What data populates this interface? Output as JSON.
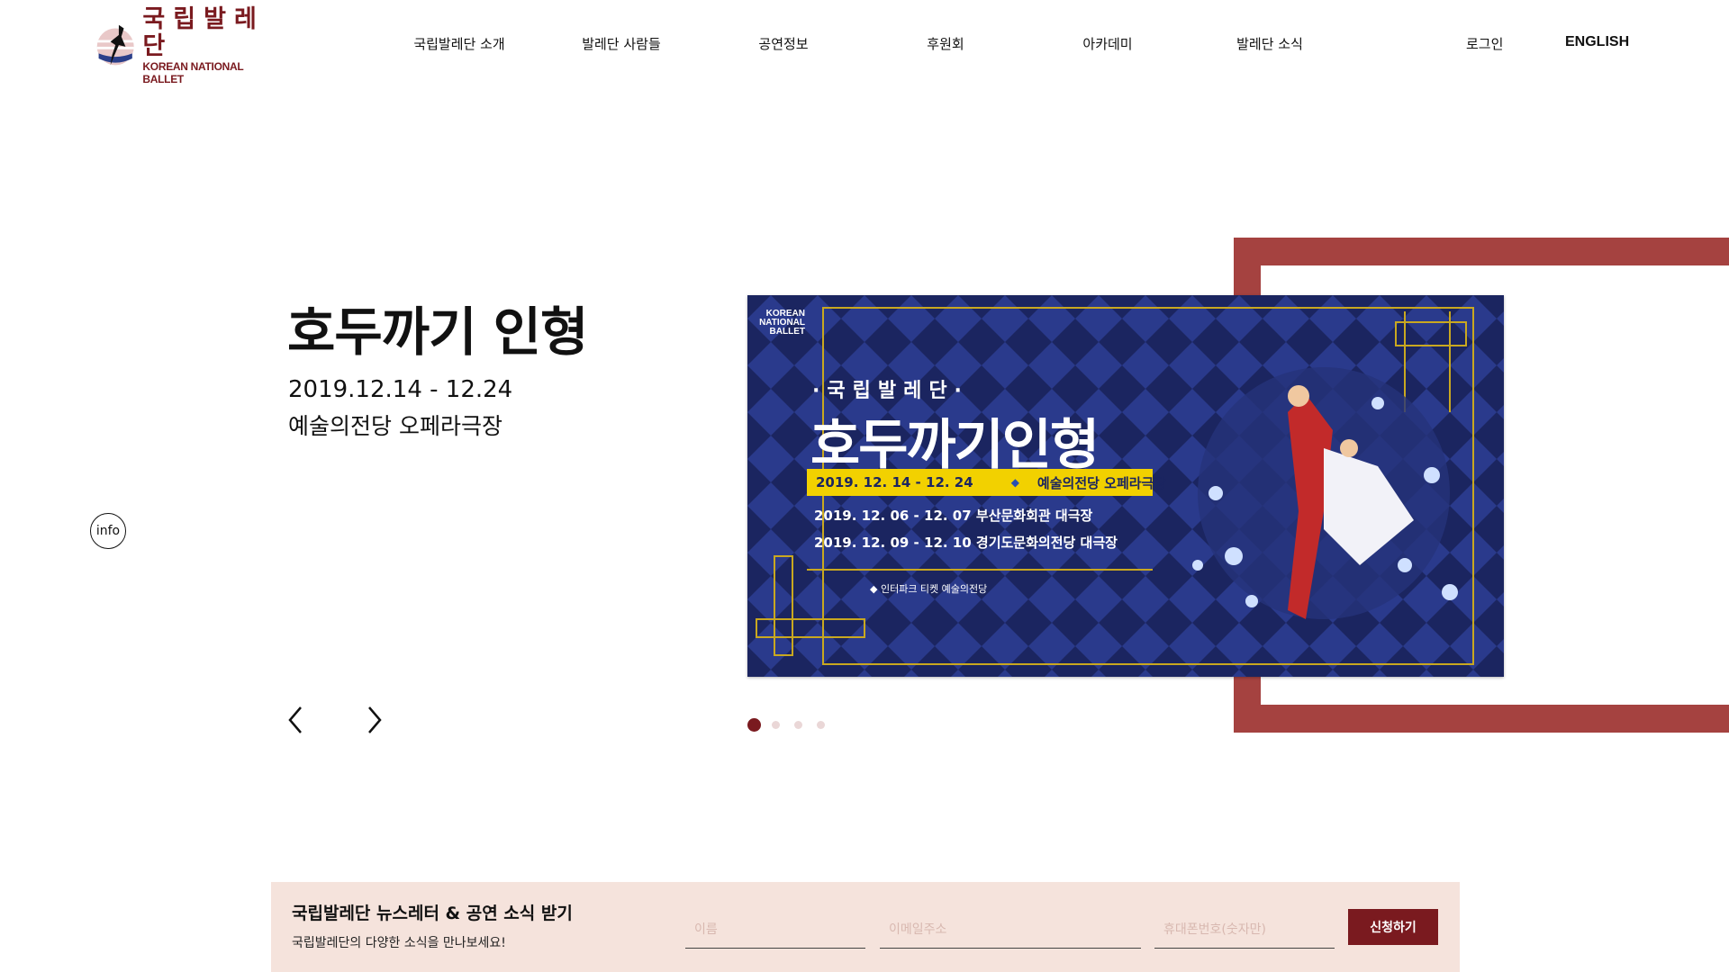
{
  "brand": {
    "name_kr": "국립발레단",
    "name_en": "KOREAN NATIONAL BALLET",
    "color": "#7a1a1f"
  },
  "nav": {
    "items": [
      {
        "label": "국립발레단 소개"
      },
      {
        "label": "발레단 사람들"
      },
      {
        "label": "공연정보"
      },
      {
        "label": "후원회"
      },
      {
        "label": "아카데미"
      },
      {
        "label": "발레단 소식"
      }
    ],
    "login": "로그인",
    "english": "ENGLISH"
  },
  "hero": {
    "title": "호두까기 인형",
    "date": "2019.12.14 - 12.24",
    "venue": "예술의전당 오페라극장",
    "info_label": "info",
    "prev_icon": "chevron-left-icon",
    "next_icon": "chevron-right-icon"
  },
  "poster": {
    "brand_en": "KOREAN NATIONAL BALLET",
    "brand_kr": "국립발레단",
    "subtitle": "·국립발레단·",
    "title": "호두까기인형",
    "band_date": "2019. 12. 14 - 12. 24",
    "band_venue": "예술의전당 오페라극장",
    "line1": "2019. 12. 06 - 12. 07  부산문화회관 대극장",
    "line2": "2019. 12. 09 - 12. 10  경기도문화의전당 대극장",
    "sponsors": "◆  인터파크 티켓    예술의전당",
    "colors": {
      "background": "#1b2560",
      "diamond": "#2a3a8c",
      "band": "#f2d100"
    }
  },
  "slider": {
    "total": 4,
    "active_index": 0,
    "active_color": "#7a1a1f",
    "inactive_color": "#ead7d7"
  },
  "frame": {
    "color": "#a54240"
  },
  "newsletter": {
    "title": "국립발레단 뉴스레터 & 공연 소식 받기",
    "subtitle": "국립발레단의 다양한 소식을 만나보세요!",
    "name_placeholder": "이름",
    "email_placeholder": "이메일주소",
    "phone_placeholder": "휴대폰번호(숫자만)",
    "submit_label": "신청하기",
    "background": "#f5e3dc"
  }
}
